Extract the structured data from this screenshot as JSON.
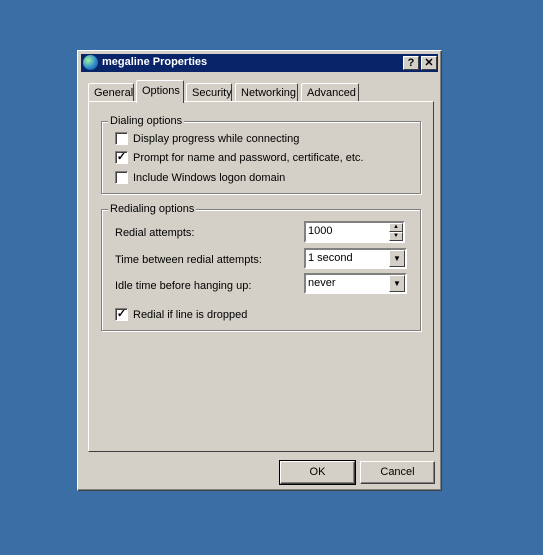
{
  "window": {
    "title": "megaline Properties",
    "help_button": "?",
    "close_button": "✕"
  },
  "tabs": [
    {
      "label": "General"
    },
    {
      "label": "Options"
    },
    {
      "label": "Security"
    },
    {
      "label": "Networking"
    },
    {
      "label": "Advanced"
    }
  ],
  "active_tab": "Options",
  "dialing": {
    "group_label": "Dialing options",
    "items": [
      {
        "label": "Display progress while connecting",
        "checked": false
      },
      {
        "label": "Prompt for name and password, certificate, etc.",
        "checked": true
      },
      {
        "label": "Include Windows logon domain",
        "checked": false
      }
    ]
  },
  "redialing": {
    "group_label": "Redialing options",
    "attempts_label": "Redial attempts:",
    "attempts_value": "1000",
    "time_between_label": "Time between redial attempts:",
    "time_between_value": "1 second",
    "idle_label": "Idle time before hanging up:",
    "idle_value": "never",
    "redial_dropped": {
      "label": "Redial if line is dropped",
      "checked": true
    }
  },
  "buttons": {
    "ok": "OK",
    "cancel": "Cancel"
  }
}
